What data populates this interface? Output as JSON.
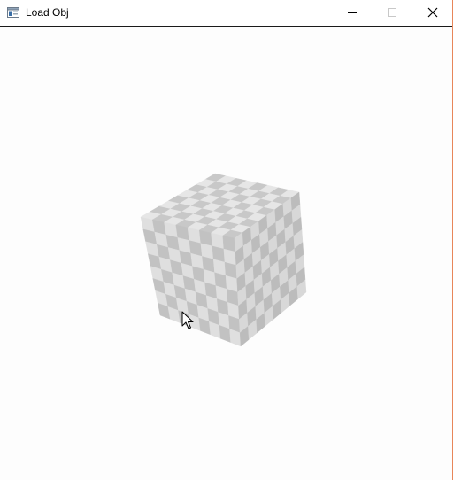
{
  "window": {
    "title": "Load Obj",
    "icons": {
      "app": "window-app-icon",
      "minimize": "minimize-icon",
      "maximize": "maximize-icon",
      "close": "close-icon"
    },
    "maximize_enabled": false
  },
  "scene": {
    "object": "checkered-cube",
    "colors": {
      "light": "#e6e6e6",
      "dark": "#c8c8c8",
      "background": "#fdfdfd",
      "window_border": "#e8865a"
    }
  }
}
